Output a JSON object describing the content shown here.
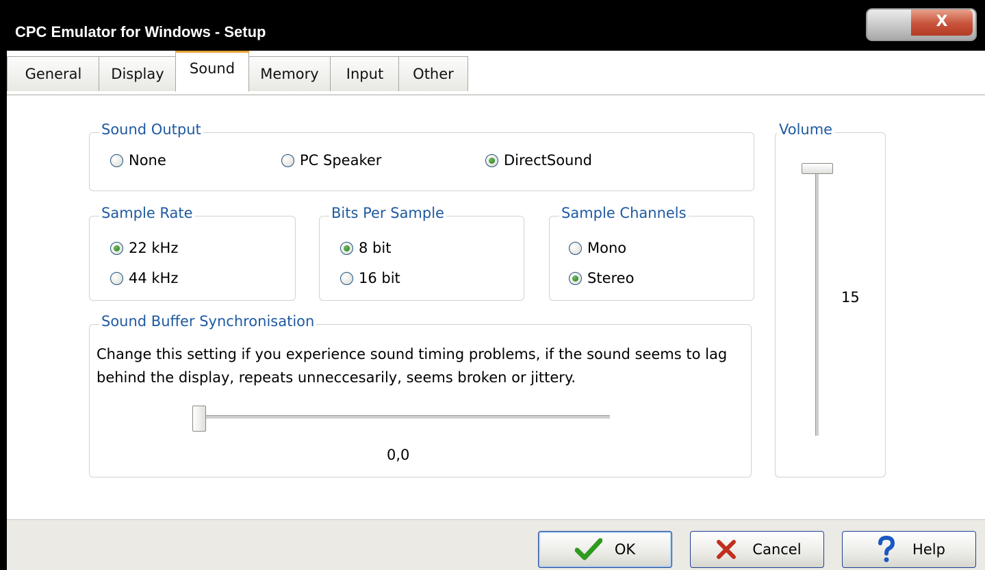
{
  "window": {
    "title": "CPC Emulator for Windows - Setup",
    "close_glyph": "X"
  },
  "tabs": [
    {
      "label": "General"
    },
    {
      "label": "Display"
    },
    {
      "label": "Sound"
    },
    {
      "label": "Memory"
    },
    {
      "label": "Input"
    },
    {
      "label": "Other"
    }
  ],
  "active_tab": "Sound",
  "sound_output": {
    "legend": "Sound Output",
    "options": [
      {
        "label": "None",
        "selected": false
      },
      {
        "label": "PC Speaker",
        "selected": false
      },
      {
        "label": "DirectSound",
        "selected": true
      }
    ]
  },
  "sample_rate": {
    "legend": "Sample Rate",
    "options": [
      {
        "label": "22 kHz",
        "selected": true
      },
      {
        "label": "44 kHz",
        "selected": false
      }
    ]
  },
  "bits_per_sample": {
    "legend": "Bits Per Sample",
    "options": [
      {
        "label": "8 bit",
        "selected": true
      },
      {
        "label": "16 bit",
        "selected": false
      }
    ]
  },
  "sample_channels": {
    "legend": "Sample Channels",
    "options": [
      {
        "label": "Mono",
        "selected": false
      },
      {
        "label": "Stereo",
        "selected": true
      }
    ]
  },
  "buffer_sync": {
    "legend": "Sound Buffer Synchronisation",
    "description": "Change this setting if you experience sound timing problems, if the sound seems to lag behind the display, repeats unneccesarily, seems broken or jittery.",
    "value_text": "0,0",
    "slider_fraction": 0
  },
  "volume": {
    "legend": "Volume",
    "value": "15",
    "slider_fraction": 1
  },
  "buttons": {
    "ok": "OK",
    "cancel": "Cancel",
    "help": "Help"
  },
  "colors": {
    "legend_text": "#1f5aa0",
    "ok_check": "#2e9a1e",
    "cancel_x": "#c0301c",
    "help_q": "#1a58c4"
  }
}
